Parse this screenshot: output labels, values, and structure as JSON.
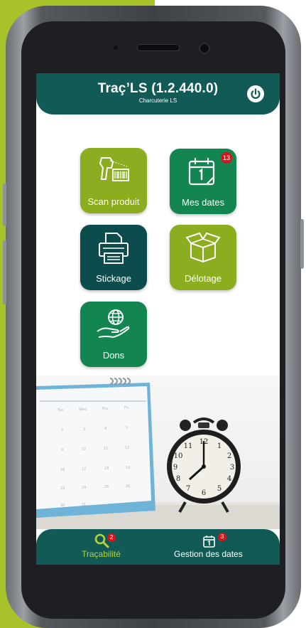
{
  "app": {
    "title": "Traç’LS (1.2.440.0)",
    "subtitle": "Charcuterie LS"
  },
  "tiles": [
    {
      "label": "Scan produit",
      "icon": "barcode-scanner-icon"
    },
    {
      "label": "Mes dates",
      "icon": "calendar-icon",
      "badge": "13"
    },
    {
      "label": "Stickage",
      "icon": "printer-icon"
    },
    {
      "label": "Délotage",
      "icon": "open-box-icon"
    },
    {
      "label": "Dons",
      "icon": "hand-globe-icon"
    }
  ],
  "footer": {
    "tabs": [
      {
        "label": "Traçabilité",
        "icon": "search-icon",
        "badge": "2",
        "active": true
      },
      {
        "label": "Gestion des dates",
        "icon": "calendar-icon",
        "badge": "3",
        "active": false
      }
    ]
  },
  "colors": {
    "background_accent": "#a8c32a",
    "header": "#125a56",
    "tile_lime": "#8cad1f",
    "tile_emerald": "#128551",
    "tile_teal": "#0d4c4c",
    "badge": "#d9141b",
    "active_tab": "#b8d23a"
  }
}
